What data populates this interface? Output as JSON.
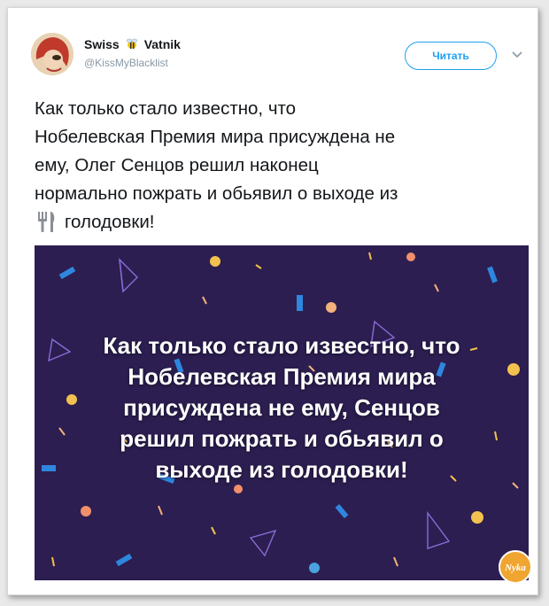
{
  "author": {
    "name_left": "Swiss",
    "name_right": "Vatnik",
    "handle": "@KissMyBlacklist"
  },
  "follow_button": {
    "label": "Читать"
  },
  "tweet": {
    "lines": [
      "Как только стало известно, что",
      "Нобелевская Премия мира присуждена не",
      "ему, Олег Сенцов решил наконец",
      "нормально пожрать и обьявил о выходе из",
      "голодовки!"
    ]
  },
  "media_image": {
    "lines": [
      "Как только стало известно, что",
      "Нобелевская Премия мира",
      "присуждена не ему, Сенцов",
      "решил пожрать и обьявил о",
      "выходе из голодовки!"
    ],
    "background_color": "#2c1e50"
  },
  "watermark": {
    "text": "Nyka"
  },
  "colors": {
    "accent": "#1da1f2",
    "text": "#14171a",
    "muted": "#8899a6"
  }
}
